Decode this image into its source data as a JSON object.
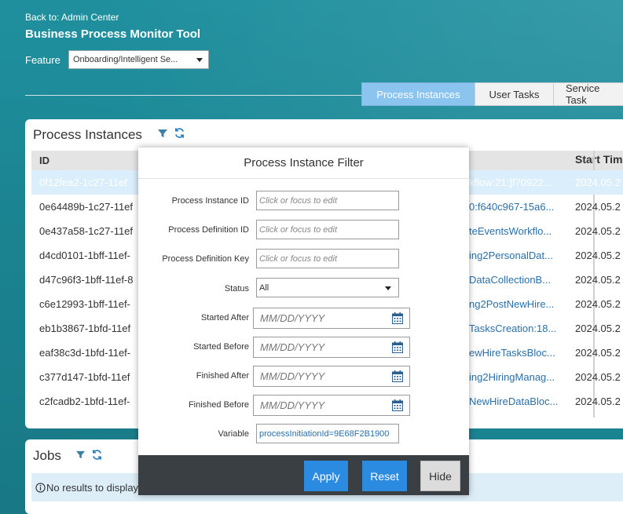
{
  "header": {
    "back_link": "Back to: Admin Center",
    "title": "Business Process Monitor Tool",
    "feature_label": "Feature",
    "feature_value": "Onboarding/Intelligent Se..."
  },
  "tabs": [
    {
      "label": "Process Instances",
      "active": true
    },
    {
      "label": "User Tasks",
      "active": false
    },
    {
      "label": "Service Task",
      "active": false
    }
  ],
  "process_panel": {
    "title": "Process Instances",
    "columns": {
      "id": "ID",
      "start_time": "Start Tim"
    },
    "rows": [
      {
        "id": "0f12fea2-1c27-11ef",
        "definition": "kflow:21:]f70922...",
        "start": "2024.05.2",
        "selected": true
      },
      {
        "id": "0e64489b-1c27-11ef",
        "definition": "0:f640c967-15a6...",
        "start": "2024.05.2",
        "selected": false
      },
      {
        "id": "0e437a58-1c27-11ef",
        "definition": "teEventsWorkflo...",
        "start": "2024.05.2",
        "selected": false
      },
      {
        "id": "d4cd0101-1bff-11ef-",
        "definition": "ing2PersonalDat...",
        "start": "2024.05.2",
        "selected": false
      },
      {
        "id": "d47c96f3-1bff-11ef-8",
        "definition": "DataCollectionB...",
        "start": "2024.05.2",
        "selected": false
      },
      {
        "id": "c6e12993-1bff-11ef-",
        "definition": "ng2PostNewHire...",
        "start": "2024.05.2",
        "selected": false
      },
      {
        "id": "eb1b3867-1bfd-11ef",
        "definition": "TasksCreation:18...",
        "start": "2024.05.2",
        "selected": false
      },
      {
        "id": "eaf38c3d-1bfd-11ef-",
        "definition": "ewHireTasksBloc...",
        "start": "2024.05.2",
        "selected": false
      },
      {
        "id": "c377d147-1bfd-11ef",
        "definition": "ing2HiringManag...",
        "start": "2024.05.2",
        "selected": false
      },
      {
        "id": "c2fcadb2-1bfd-11ef-",
        "definition": "NewHireDataBloc...",
        "start": "2024.05.2",
        "selected": false
      }
    ]
  },
  "jobs_panel": {
    "title": "Jobs",
    "no_results": "No results to display"
  },
  "filter_dialog": {
    "title": "Process Instance Filter",
    "fields": {
      "process_instance_id": {
        "label": "Process Instance ID",
        "placeholder": "Click or focus to edit"
      },
      "process_definition_id": {
        "label": "Process Definition ID",
        "placeholder": "Click or focus to edit"
      },
      "process_definition_key": {
        "label": "Process Definition Key",
        "placeholder": "Click or focus to edit"
      },
      "status": {
        "label": "Status",
        "value": "All"
      },
      "started_after": {
        "label": "Started After",
        "placeholder": "MM/DD/YYYY"
      },
      "started_before": {
        "label": "Started Before",
        "placeholder": "MM/DD/YYYY"
      },
      "finished_after": {
        "label": "Finished After",
        "placeholder": "MM/DD/YYYY"
      },
      "finished_before": {
        "label": "Finished Before",
        "placeholder": "MM/DD/YYYY"
      },
      "variable": {
        "label": "Variable",
        "value": "processInitiationId=9E68F2B1900"
      }
    },
    "buttons": {
      "apply": "Apply",
      "reset": "Reset",
      "hide": "Hide"
    }
  },
  "colors": {
    "background": "#1c8795",
    "accent_button": "#2a8be0",
    "active_tab": "#8bc4ee",
    "link": "#2a6fa5",
    "footer": "#3a3f44"
  }
}
